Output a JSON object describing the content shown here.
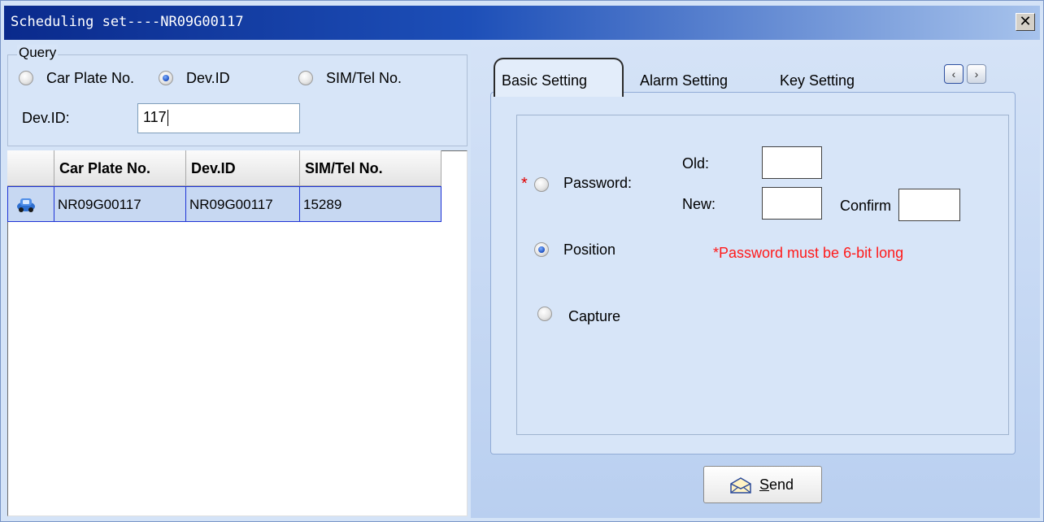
{
  "window": {
    "title": "Scheduling set----NR09G00117",
    "close_label": "✕"
  },
  "query": {
    "legend": "Query",
    "options": [
      {
        "label": "Car Plate No.",
        "checked": false
      },
      {
        "label": "Dev.ID",
        "checked": true
      },
      {
        "label": "SIM/Tel No.",
        "checked": false
      }
    ],
    "field_label": "Dev.ID:",
    "field_value": "117"
  },
  "grid": {
    "columns": [
      "",
      "Car Plate No.",
      "Dev.ID",
      "SIM/Tel No."
    ],
    "rows": [
      {
        "icon": "car-icon",
        "car_plate": "NR09G00117",
        "dev_id": "NR09G00117",
        "sim": "15289"
      }
    ]
  },
  "tabs": [
    {
      "label": "Basic Setting",
      "active": true
    },
    {
      "label": "Alarm Setting",
      "active": false
    },
    {
      "label": "Key Setting",
      "active": false
    }
  ],
  "basic": {
    "required_mark": "*",
    "options": [
      {
        "label": "Password:",
        "checked": false
      },
      {
        "label": "Position",
        "checked": true
      },
      {
        "label": "Capture",
        "checked": false
      }
    ],
    "old_label": "Old:",
    "new_label": "New:",
    "confirm_label": "Confirm",
    "warning": "*Password must be 6-bit long"
  },
  "send": {
    "hotkey": "S",
    "rest": "end"
  },
  "colors": {
    "title_start": "#0a2a8c",
    "selected_row": "#c7d8f2",
    "warning": "#ff1a1a"
  }
}
